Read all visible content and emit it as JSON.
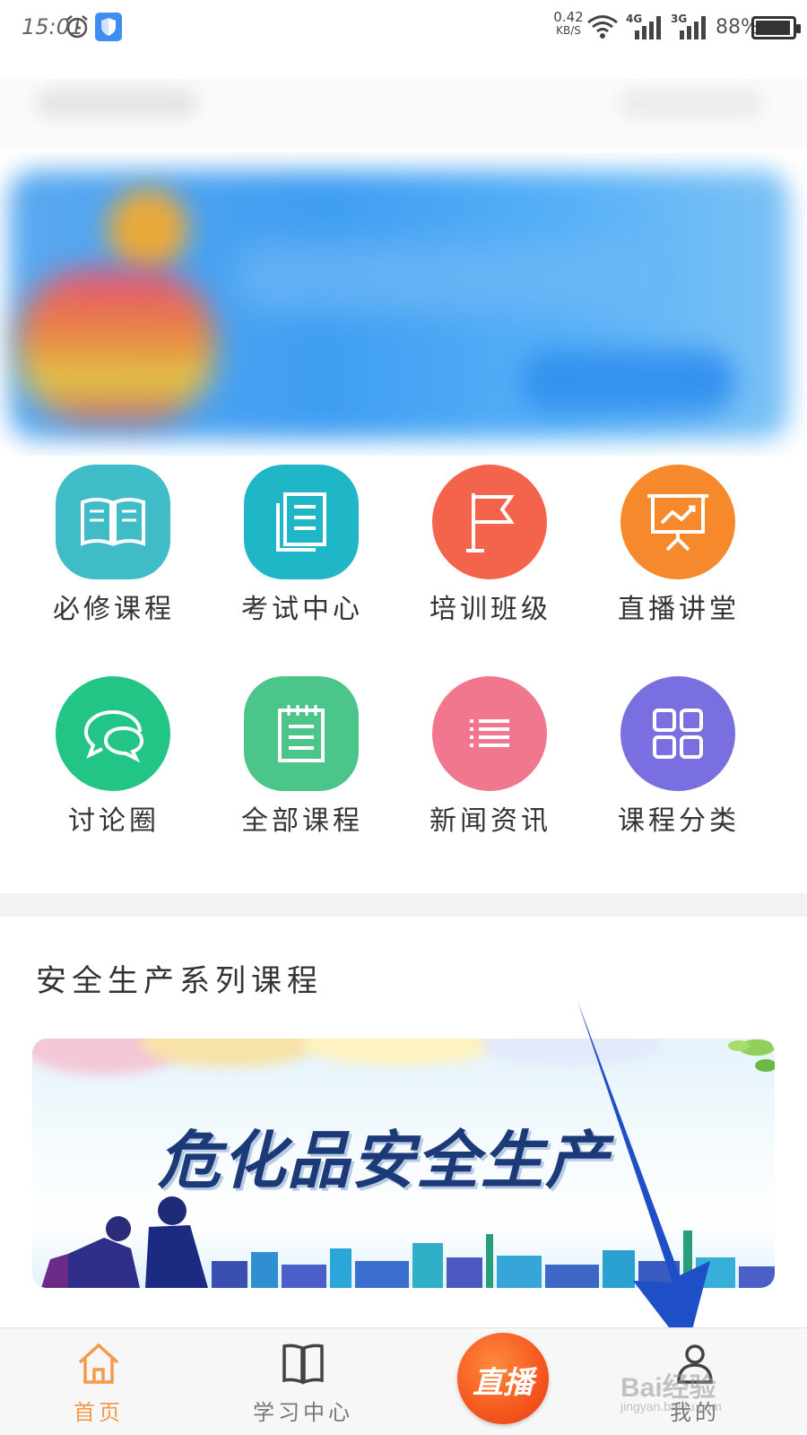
{
  "status_bar": {
    "time": "15:01",
    "net_speed_value": "0.42",
    "net_speed_unit": "KB/S",
    "network_1": "4G",
    "network_2": "3G",
    "battery": "88%"
  },
  "menu": {
    "items": [
      {
        "label": "必修课程",
        "icon": "book-icon",
        "color": "#3fbcc8"
      },
      {
        "label": "考试中心",
        "icon": "document-icon",
        "color": "#1fb6c7"
      },
      {
        "label": "培训班级",
        "icon": "flag-icon",
        "color": "#f4644c"
      },
      {
        "label": "直播讲堂",
        "icon": "presentation-icon",
        "color": "#f5892c"
      },
      {
        "label": "讨论圈",
        "icon": "chat-bubbles-icon",
        "color": "#22c586"
      },
      {
        "label": "全部课程",
        "icon": "calendar-list-icon",
        "color": "#4cc58b"
      },
      {
        "label": "新闻资讯",
        "icon": "list-icon",
        "color": "#f1778e"
      },
      {
        "label": "课程分类",
        "icon": "grid-icon",
        "color": "#7a6fe0"
      }
    ]
  },
  "section": {
    "title": "安全生产系列课程"
  },
  "course_banner": {
    "title": "危化品安全生产"
  },
  "bottom_nav": {
    "home": "首页",
    "study": "学习中心",
    "live": "直播",
    "mine": "我的"
  },
  "watermark": {
    "main": "Bai经验",
    "sub": "jingyan.baidu.com"
  },
  "colors": {
    "active": "#f39a4b",
    "arrow": "#1f4fc7"
  }
}
